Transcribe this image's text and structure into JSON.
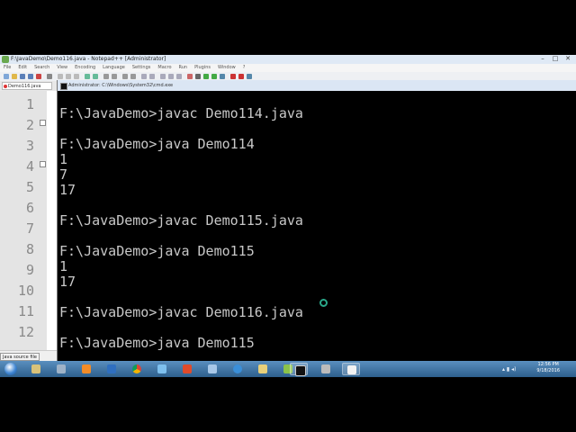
{
  "npp": {
    "title": "F:\\JavaDemo\\Demo116.java - Notepad++ [Administrator]",
    "menu": [
      "File",
      "Edit",
      "Search",
      "View",
      "Encoding",
      "Language",
      "Settings",
      "Macro",
      "Run",
      "Plugins",
      "Window",
      "?"
    ],
    "tab_label": "Demo116.java",
    "line_numbers": [
      "1",
      "2",
      "3",
      "4",
      "5",
      "6",
      "7",
      "8",
      "9",
      "10",
      "11",
      "12"
    ],
    "status_text": "Java source file",
    "tooltip": "Java source file"
  },
  "cmd": {
    "title": "Administrator: C:\\Windows\\System32\\cmd.exe",
    "lines": [
      "F:\\JavaDemo>javac Demo114.java",
      "",
      "F:\\JavaDemo>java Demo114",
      "1",
      "7",
      "17",
      "",
      "F:\\JavaDemo>javac Demo115.java",
      "",
      "F:\\JavaDemo>java Demo115",
      "1",
      "17",
      "",
      "F:\\JavaDemo>javac Demo116.java",
      "",
      "F:\\JavaDemo>java Demo115"
    ]
  },
  "taskbar": {
    "clock_time": "12:56 PM",
    "clock_date": "9/18/2016",
    "icons": [
      "start-orb",
      "explorer-icon",
      "calculator-icon",
      "media-player-icon",
      "network-icon",
      "chrome-icon",
      "search-icon",
      "presentation-icon",
      "folder-icon",
      "ie-icon",
      "archive-icon",
      "notepadpp-icon",
      "cmd-icon",
      "tools-icon",
      "snipping-icon"
    ]
  },
  "colors": {
    "cmd_bg": "#000000",
    "cmd_text": "#c8c8c8",
    "taskbar": "#2d5f8c",
    "cursor_ring": "#2aa88a"
  }
}
